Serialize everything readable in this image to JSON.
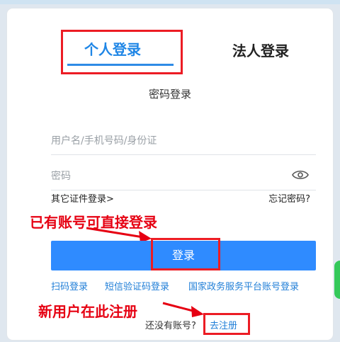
{
  "tabs": {
    "personal_label": "个人登录",
    "legal_label": "法人登录"
  },
  "subtitle": "密码登录",
  "form": {
    "username_placeholder": "用户名/手机号码/身份证",
    "password_placeholder": "密码"
  },
  "links": {
    "other_login": "其它证件登录>",
    "forgot": "忘记密码?"
  },
  "annotations": {
    "existing": "已有账号可直接登录",
    "new_user": "新用户在此注册"
  },
  "login_button": "登录",
  "quick_login": {
    "scan": "扫码登录",
    "sms": "短信验证码登录",
    "gov": "国家政务服务平台账号登录"
  },
  "register": {
    "no_account": "还没有账号?",
    "link": "去注册"
  },
  "colors": {
    "accent": "#2f8bff",
    "annotation_red": "#e60012"
  },
  "icons": {
    "password_visibility": "eye-icon"
  }
}
